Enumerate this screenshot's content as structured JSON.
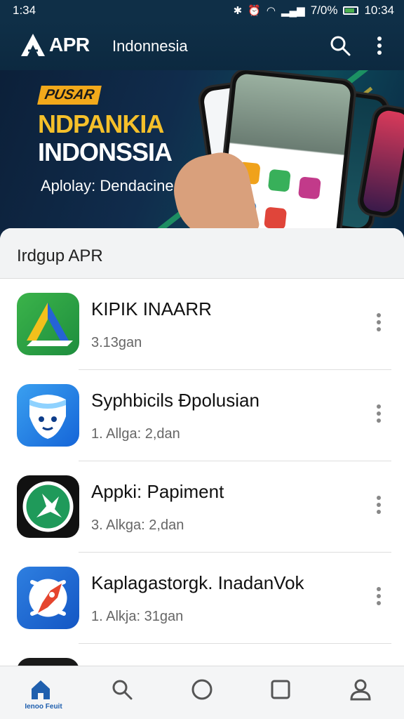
{
  "status_bar": {
    "time": "1:34",
    "battery": "7/0%",
    "clock_right": "10:34"
  },
  "app_bar": {
    "logo_text": "APR",
    "region": "Indonnesia"
  },
  "banner": {
    "tag": "PUSAR",
    "title_line1": "NDPANKIA",
    "title_line2": "INDONSSIA",
    "subtitle": "Aplolay: Dendacine"
  },
  "section": {
    "title": "Irdgup APR"
  },
  "apps": [
    {
      "name": "KIPIK INAARR",
      "meta": "3.13gan",
      "icon": "drive-triangle-icon"
    },
    {
      "name": "Syphbicils Đpolusian",
      "meta": "1. Allga: 2,dan",
      "icon": "shield-face-icon"
    },
    {
      "name": "Appki: Papiment",
      "meta": "3. Alkga: 2,dan",
      "icon": "green-star-icon"
    },
    {
      "name": "Kaplagastorgk. InadanVok",
      "meta": "1. Alkja: 31gan",
      "icon": "rocket-icon"
    }
  ],
  "bottom_nav": {
    "home_label": "Ienoo Feuit"
  },
  "colors": {
    "appbar": "#0f2f47",
    "accent_blue": "#1f5fae",
    "banner_gold": "#f5c02a"
  }
}
